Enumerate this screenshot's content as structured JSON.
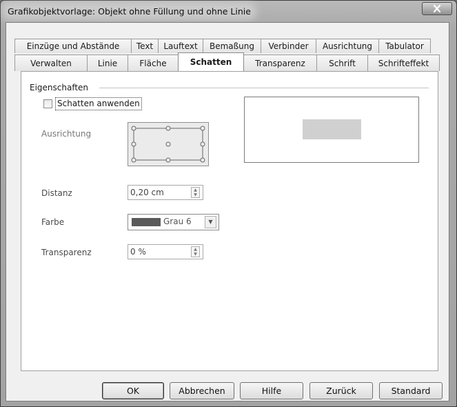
{
  "window": {
    "title": "Grafikobjektvorlage: Objekt ohne Füllung und ohne Linie",
    "close_icon": "close-x-icon"
  },
  "tabs_row1": [
    {
      "label": "Einzüge und Abstände"
    },
    {
      "label": "Text"
    },
    {
      "label": "Lauftext"
    },
    {
      "label": "Bemaßung"
    },
    {
      "label": "Verbinder"
    },
    {
      "label": "Ausrichtung"
    },
    {
      "label": "Tabulator"
    }
  ],
  "tabs_row2": [
    {
      "label": "Verwalten"
    },
    {
      "label": "Linie"
    },
    {
      "label": "Fläche"
    },
    {
      "label": "Schatten",
      "active": true
    },
    {
      "label": "Transparenz"
    },
    {
      "label": "Schrift"
    },
    {
      "label": "Schrifteffekt"
    }
  ],
  "properties": {
    "section_title": "Eigenschaften",
    "apply_shadow": {
      "label": "Schatten anwenden",
      "checked": false
    },
    "orientation_label": "Ausrichtung",
    "distance": {
      "label": "Distanz",
      "value": "0,20 cm"
    },
    "color": {
      "label": "Farbe",
      "value": "Grau 6",
      "swatch": "#5a5a5a"
    },
    "transparency": {
      "label": "Transparenz",
      "value": "0 %"
    }
  },
  "buttons": {
    "ok": "OK",
    "cancel": "Abbrechen",
    "help": "Hilfe",
    "back": "Zurück",
    "standard": "Standard"
  }
}
